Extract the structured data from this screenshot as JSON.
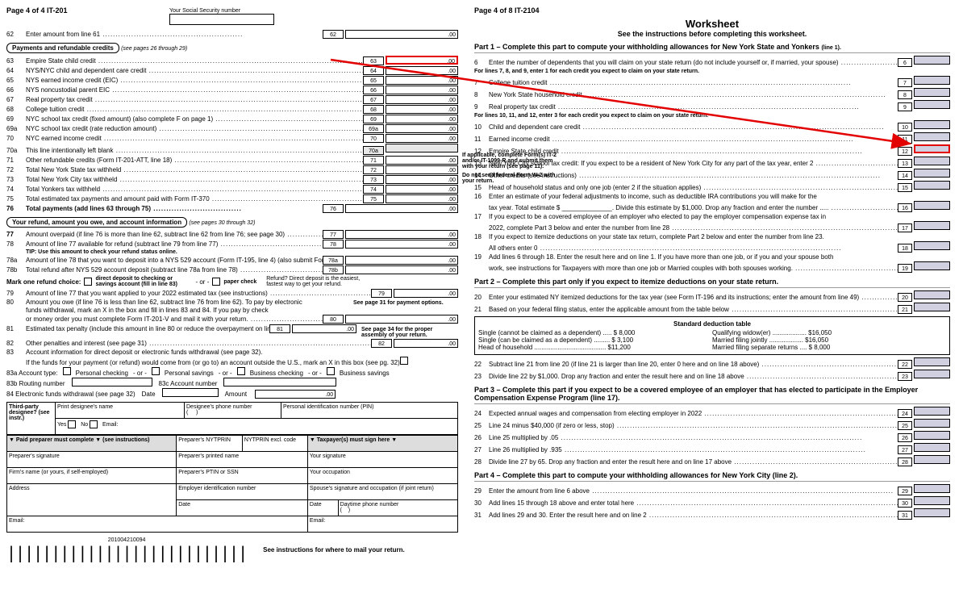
{
  "left": {
    "page_header": "Page 4 of 4   IT-201",
    "ssn_label": "Your Social Security number",
    "line62": {
      "num": "62",
      "text": "Enter amount from line 61",
      "box": "62",
      "amt": ".00"
    },
    "section_payments": "Payments and refundable credits",
    "payments_see": "(see pages 26 through 29)",
    "lines_payments": [
      {
        "num": "63",
        "text": "Empire State child credit",
        "box": "63",
        "amt": ".00",
        "highlight": true
      },
      {
        "num": "64",
        "text": "NYS/NYC child and dependent care credit",
        "box": "64",
        "amt": ".00"
      },
      {
        "num": "65",
        "text": "NYS earned income credit (EIC)",
        "box": "65",
        "amt": ".00"
      },
      {
        "num": "66",
        "text": "NYS noncustodial parent EIC",
        "box": "66",
        "amt": ".00"
      },
      {
        "num": "67",
        "text": "Real property tax credit",
        "box": "67",
        "amt": ".00"
      },
      {
        "num": "68",
        "text": "College tuition credit",
        "box": "68",
        "amt": ".00"
      },
      {
        "num": "69",
        "text": "NYC school tax credit (fixed amount) (also complete F on page 1)",
        "box": "69",
        "amt": ".00"
      },
      {
        "num": "69a",
        "text": "NYC school tax credit (rate reduction amount)",
        "box": "69a",
        "amt": ".00"
      },
      {
        "num": "70",
        "text": "NYC earned income credit",
        "box": "70",
        "amt": ".00"
      },
      {
        "num": "70a",
        "text": "This line intentionally left blank",
        "box": "70a",
        "amt": "",
        "shaded": true
      },
      {
        "num": "71",
        "text": "Other refundable credits (Form IT-201-ATT, line 18)",
        "box": "71",
        "amt": ".00"
      },
      {
        "num": "72",
        "text": "Total New York State tax withheld",
        "box": "72",
        "amt": ".00"
      },
      {
        "num": "73",
        "text": "Total New York City tax withheld",
        "box": "73",
        "amt": ".00"
      },
      {
        "num": "74",
        "text": "Total Yonkers tax withheld",
        "box": "74",
        "amt": ".00"
      },
      {
        "num": "75",
        "text": "Total estimated tax payments and amount paid with Form IT-370",
        "box": "75",
        "amt": ".00"
      }
    ],
    "side_note1": "If applicable, complete Form(s) IT-2 and/or IT-1099-R and submit them with your return (see page 11).",
    "side_note2": "Do not send federal Form W-2 with your return.",
    "line76": {
      "num": "76",
      "text": "Total payments (add lines 63 through 75)",
      "box": "76",
      "amt": ".00"
    },
    "section_refund": "Your refund, amount you owe, and account information",
    "refund_see": "(see pages 30 through 32)",
    "line77": {
      "num": "77",
      "text": "Amount overpaid (if line 76 is more than line 62, subtract line 62 from line 76; see page 30)",
      "box": "77",
      "amt": ".00"
    },
    "line78": {
      "num": "78",
      "text": "Amount of line 77 available for refund (subtract line 79 from line 77)",
      "box": "78",
      "amt": ".00"
    },
    "line78_tip": "TIP: Use this amount to check your refund status online.",
    "line78a": {
      "num": "78a",
      "text": "Amount of line 78 that you want to deposit into a NYS 529 account (Form IT-195, line 4) (also submit Form IT-195)",
      "box": "78a",
      "amt": ".00"
    },
    "line78b": {
      "num": "78b",
      "text": "Total refund after NYS 529 account deposit (subtract line 78a from line 78)",
      "box": "78b",
      "amt": ".00"
    },
    "refund_choice_label": "Mark one refund choice:",
    "refund_dd": "direct deposit to checking or savings account (fill in line 83)",
    "refund_or": "- or -",
    "refund_paper": "paper check",
    "refund_note": "Refund? Direct deposit is the easiest, fastest way to get your refund.",
    "line79": {
      "num": "79",
      "text": "Amount of line 77 that you want applied to your 2022 estimated tax (see instructions)",
      "box": "79",
      "amt": ".00"
    },
    "line80_text1": "Amount you owe (if line 76 is less than line 62, subtract line 76 from line 62). To pay by electronic",
    "line80_text2": "funds withdrawal, mark an X in the box        and fill in lines 83 and 84. If you pay by check",
    "line80_text3": "or money order you must complete Form IT-201-V and mail it with your return.",
    "line80_box": "80",
    "line80_amt": ".00",
    "line80_note": "See page 31 for payment options.",
    "line81": {
      "num": "81",
      "text": "Estimated tax penalty (include this amount in line 80 or reduce the overpayment on line 77; see page 31)",
      "box": "81",
      "amt": ".00"
    },
    "line82": {
      "num": "82",
      "text": "Other penalties and interest (see page 31)",
      "box": "82",
      "amt": ".00"
    },
    "line82_note": "See page 34 for the proper assembly of your return.",
    "line83_text": "Account information for direct deposit or electronic funds withdrawal (see page 32).",
    "line83_text2": "If the funds for your payment (or refund) would come from (or go to) an account outside the U.S., mark an X in this box (see pg. 32)",
    "acct_type_label": "83a  Account type:",
    "acct_pc": "Personal checking",
    "acct_ps": "Personal savings",
    "acct_bc": "Business checking",
    "acct_bs": "Business savings",
    "routing_label": "83b  Routing number",
    "acct_num_label": "83c  Account number",
    "line84": "84  Electronic funds withdrawal (see page 32)",
    "date_label": "Date",
    "amount_label": "Amount",
    "amt84": ".00",
    "third_party": "Third-party designee? (see instr.)",
    "print_name": "Print designee's name",
    "designee_phone": "Designee's phone number",
    "pin": "Personal identification number (PIN)",
    "yes": "Yes",
    "no": "No",
    "email": "Email:",
    "preparer_header": "▼  Paid preparer must complete  ▼ (see instructions)",
    "prep_nyptrin": "Preparer's NYTPRIN",
    "nyptrin_excl": "NYTPRIN excl. code",
    "taxpayer_header": "▼   Taxpayer(s) must sign here   ▼",
    "prep_sig": "Preparer's signature",
    "prep_name": "Preparer's printed name",
    "your_sig": "Your signature",
    "firm_name": "Firm's name (or yours, if self-employed)",
    "prep_ptin": "Preparer's PTIN or SSN",
    "your_occ": "Your occupation",
    "address": "Address",
    "ein": "Employer identification number",
    "spouse_sig": "Spouse's signature and occupation (if joint return)",
    "prep_date": "Date",
    "sig_date": "Date",
    "daytime_phone": "Daytime phone number",
    "prep_email": "Email:",
    "sig_email": "Email:",
    "mail_instr": "See instructions for where to mail your return.",
    "barcode_num": "201004210094"
  },
  "right": {
    "page_header": "Page 4 of 8   IT-2104",
    "title": "Worksheet",
    "subtitle": "See the instructions before completing this worksheet.",
    "part1_header": "Part 1 – Complete this part to compute your withholding allowances for New York State and Yonkers",
    "part1_suffix": "(line 1).",
    "line6": {
      "num": "6",
      "text": "Enter the number of dependents that you will claim on your state return (do not include yourself or, if married, your spouse)",
      "box": "6"
    },
    "for789": "For lines 7, 8, and 9, enter 1 for each credit you expect to claim on your state return.",
    "line7": {
      "num": "7",
      "text": "College tuition credit",
      "box": "7"
    },
    "line8": {
      "num": "8",
      "text": "New York State household credit",
      "box": "8"
    },
    "line9": {
      "num": "9",
      "text": "Real property tax credit",
      "box": "9"
    },
    "for101112": "For lines 10, 11, and 12, enter 3 for each credit you expect to claim on your state return.",
    "line10": {
      "num": "10",
      "text": "Child and dependent care credit",
      "box": "10"
    },
    "line11": {
      "num": "11",
      "text": "Earned income credit",
      "box": "11"
    },
    "line12": {
      "num": "12",
      "text": "Empire State child credit",
      "box": "12",
      "highlight": true
    },
    "line13": {
      "num": "13",
      "text": "New York City school tax credit: If you expect to be a resident of New York City for any part of the tax year, enter 2",
      "box": "13"
    },
    "line14": {
      "num": "14",
      "text": "Other credits (see instructions)",
      "box": "14"
    },
    "line15": {
      "num": "15",
      "text": "Head of household status and only one job (enter 2 if the situation applies)",
      "box": "15"
    },
    "line16a": "Enter an estimate of your federal adjustments to income, such as deductible IRA contributions you will make for the",
    "line16b": "tax year. Total estimate $ ______________. Divide this estimate by $1,000. Drop any fraction and enter the number .....",
    "line16_box": "16",
    "line17a": "If you expect to be a covered employee of an employer who elected to pay the employer compensation expense tax in",
    "line17b": "2022, complete Part 3 below and enter the number from line 28",
    "line17_box": "17",
    "line18a": "If you expect to itemize deductions on your state tax return, complete Part 2 below and enter the number from line 23.",
    "line18b": "All others enter 0",
    "line18_box": "18",
    "line19a": "Add lines 6 through 18. Enter the result here and on line 1. If you have more than one job, or if you and your spouse both",
    "line19b": "work, see instructions for Taxpayers with more than one job or Married couples with both spouses working.",
    "line19_box": "19",
    "part2_header": "Part 2 – Complete this part only if you expect to itemize deductions on your state return.",
    "line20": {
      "num": "20",
      "text": "Enter your estimated NY itemized deductions for the tax year (see Form IT-196 and its instructions; enter the amount from line 49)",
      "box": "20"
    },
    "line21": {
      "num": "21",
      "text": "Based on your federal filing status, enter the applicable amount from the table below",
      "box": "21"
    },
    "std_ded_title": "Standard deduction table",
    "std_ded": [
      {
        "label": "Single (cannot be claimed as a dependent) .....",
        "amt": "$  8,000"
      },
      {
        "label": "Single (can be claimed as a dependent) .........",
        "amt": "$  3,100"
      },
      {
        "label": "Head of household ........................................",
        "amt": "$11,200"
      },
      {
        "label": "Qualifying widow(er) ...................",
        "amt": "$16,050"
      },
      {
        "label": "Married filing jointly ...................",
        "amt": "$16,050"
      },
      {
        "label": "Married filing separate returns ....",
        "amt": "$  8,000"
      }
    ],
    "line22": {
      "num": "22",
      "text": "Subtract line 21 from line 20 (if line 21 is larger than line 20, enter 0 here and on line 18 above)",
      "box": "22"
    },
    "line23": {
      "num": "23",
      "text": "Divide line 22 by $1,000. Drop any fraction and enter the result here and on line 18 above",
      "box": "23"
    },
    "part3_header": "Part 3 – Complete this part if you expect to be a covered employee of an employer that has elected to participate in the Employer Compensation Expense Program (line 17).",
    "line24": {
      "num": "24",
      "text": "Expected annual wages and compensation from electing employer in 2022",
      "box": "24"
    },
    "line25": {
      "num": "25",
      "text": "Line 24 minus $40,000 (if zero or less, stop)",
      "box": "25"
    },
    "line26": {
      "num": "26",
      "text": "Line 25 multiplied by .05",
      "box": "26"
    },
    "line27": {
      "num": "27",
      "text": "Line 26 multiplied by .935",
      "box": "27"
    },
    "line28": {
      "num": "28",
      "text": "Divide line 27 by 65. Drop any fraction and enter the result here and on line 17 above",
      "box": "28"
    },
    "part4_header": "Part 4 – Complete this part to compute your withholding allowances for New York City (line 2).",
    "line29": {
      "num": "29",
      "text": "Enter the amount from line 6 above",
      "box": "29"
    },
    "line30": {
      "num": "30",
      "text": "Add lines 15 through 18 above and enter total here",
      "box": "30"
    },
    "line31": {
      "num": "31",
      "text": "Add lines 29 and 30. Enter the result here and on line 2",
      "box": "31"
    }
  }
}
